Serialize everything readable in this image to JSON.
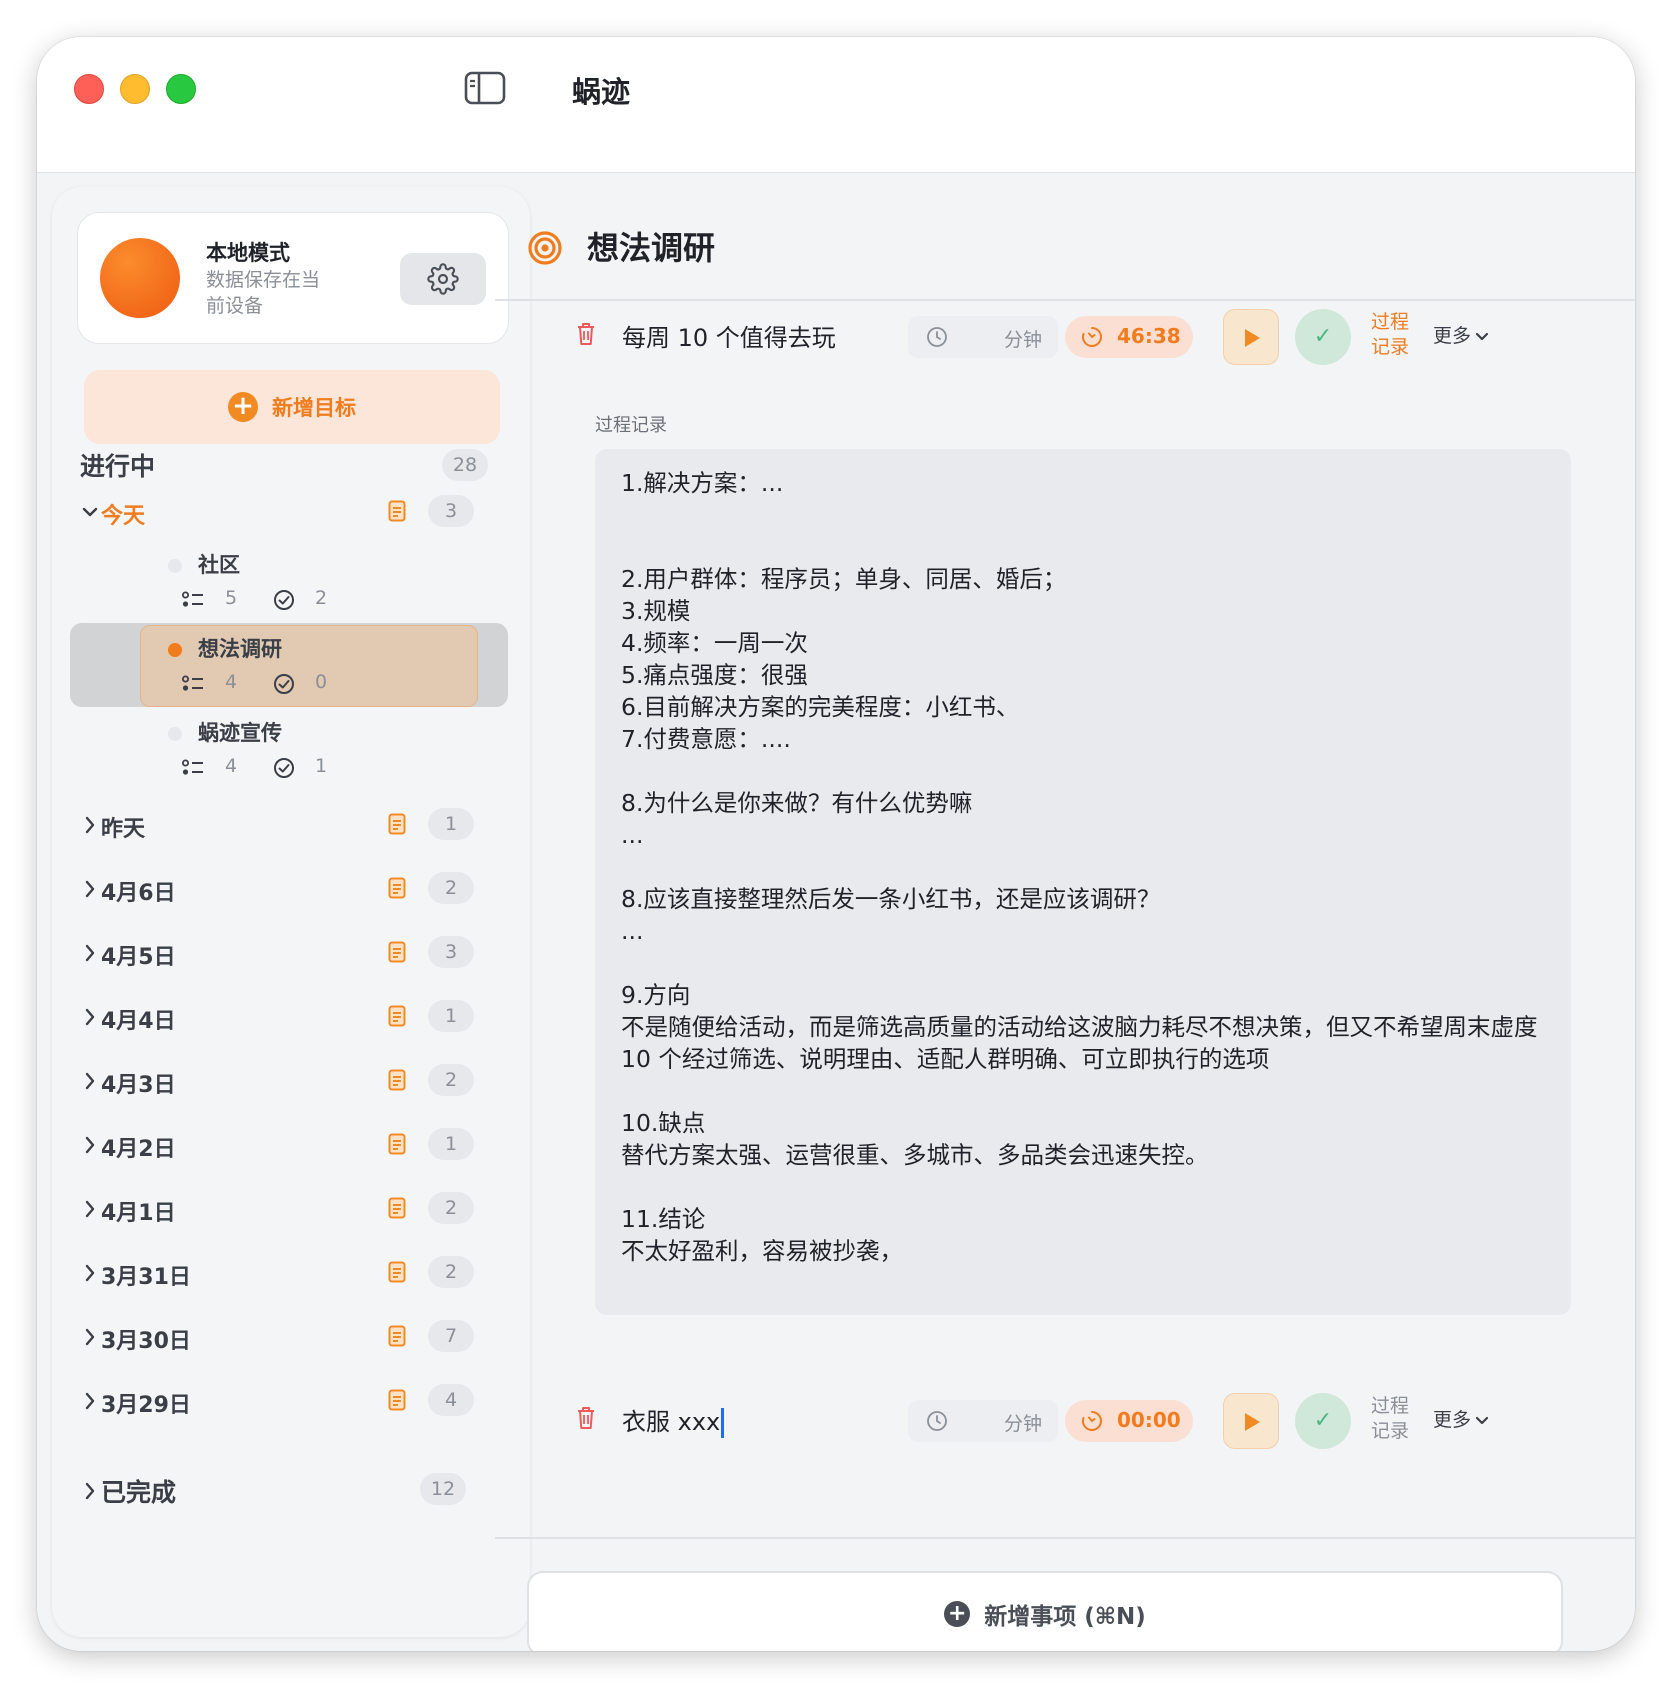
{
  "window": {
    "title": "蜗迹"
  },
  "profile": {
    "name": "本地模式",
    "description": "数据保存在当前设备"
  },
  "sidebar": {
    "add_goal_label": "新增目标",
    "in_progress": {
      "title": "进行中",
      "count": "28"
    },
    "today": {
      "label": "今天",
      "count": "3",
      "goals": [
        {
          "name": "社区",
          "tasks": "5",
          "done": "2"
        },
        {
          "name": "想法调研",
          "tasks": "4",
          "done": "0"
        },
        {
          "name": "蜗迹宣传",
          "tasks": "4",
          "done": "1"
        }
      ]
    },
    "dates": [
      {
        "label": "昨天",
        "count": "1"
      },
      {
        "label": "4月6日",
        "count": "2"
      },
      {
        "label": "4月5日",
        "count": "3"
      },
      {
        "label": "4月4日",
        "count": "1"
      },
      {
        "label": "4月3日",
        "count": "2"
      },
      {
        "label": "4月2日",
        "count": "1"
      },
      {
        "label": "4月1日",
        "count": "2"
      },
      {
        "label": "3月31日",
        "count": "2"
      },
      {
        "label": "3月30日",
        "count": "7"
      },
      {
        "label": "3月29日",
        "count": "4"
      }
    ],
    "completed": {
      "label": "已完成",
      "count": "12"
    }
  },
  "main": {
    "goal_title": "想法调研",
    "tasks": [
      {
        "name": "每周 10 个值得去玩",
        "est_unit": "分钟",
        "timer": "46:38",
        "record_label": "过程记录",
        "more_label": "更多"
      },
      {
        "name": "衣服 xxx",
        "est_unit": "分钟",
        "timer": "00:00",
        "record_label": "过程记录",
        "more_label": "更多"
      }
    ],
    "notes_label": "过程记录",
    "notes_text": "1.解决方案：...\n\n\n2.用户群体：程序员；单身、同居、婚后；\n3.规模\n4.频率：一周一次\n5.痛点强度：很强\n6.目前解决方案的完美程度：小红书、\n7.付费意愿：....\n\n8.为什么是你来做？有什么优势嘛\n...\n\n8.应该直接整理然后发一条小红书，还是应该调研？\n...\n\n9.方向\n不是随便给活动，而是筛选高质量的活动给这波脑力耗尽不想决策，但又不希望周末虚度\n10 个经过筛选、说明理由、适配人群明确、可立即执行的选项\n\n10.缺点\n替代方案太强、运营很重、多城市、多品类会迅速失控。\n\n11.结论\n不太好盈利，容易被抄袭，",
    "add_item_label": "新增事项 (⌘N)"
  },
  "colors": {
    "accent": "#f07c1e",
    "success": "#4cb782",
    "danger": "#f0595b"
  }
}
